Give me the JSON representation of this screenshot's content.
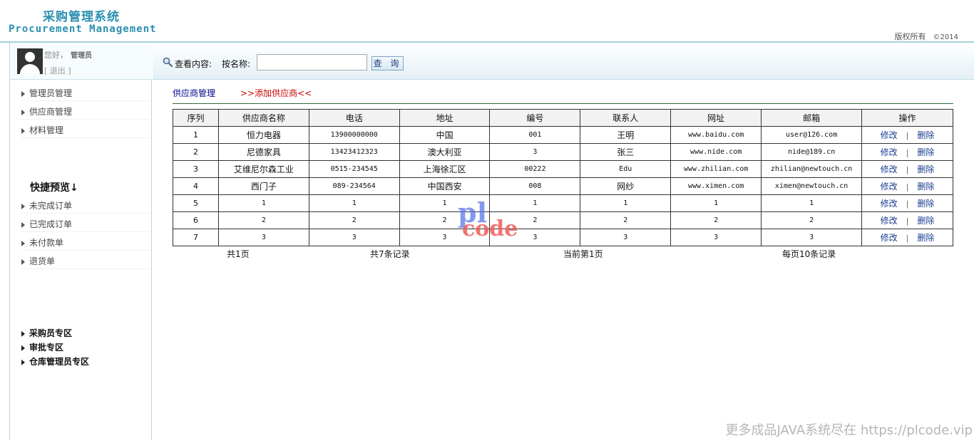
{
  "header": {
    "title_cn": "采购管理系统",
    "title_en": "Procurement Management",
    "copyright": "版权所有",
    "year": "©2014"
  },
  "user": {
    "greeting": "您好，",
    "role": "管理员",
    "logout": "[ 退出 ]"
  },
  "sidebar": {
    "menu": [
      "管理员管理",
      "供应商管理",
      "材料管理"
    ],
    "quick_title": "快捷预览↓",
    "quick": [
      "未完成订单",
      "已完成订单",
      "未付款单",
      "退货单"
    ],
    "zones": [
      "采购员专区",
      "审批专区",
      "仓库管理员专区"
    ]
  },
  "search": {
    "label": "查看内容:",
    "field_label": "按名称:",
    "value": "",
    "button": "查 询"
  },
  "content": {
    "breadcrumb": "供应商管理",
    "add_link": ">>添加供应商<<"
  },
  "table": {
    "headers": [
      "序列",
      "供应商名称",
      "电话",
      "地址",
      "编号",
      "联系人",
      "网址",
      "邮箱",
      "操作"
    ],
    "rows": [
      [
        "1",
        "恒力电器",
        "13900000000",
        "中国",
        "001",
        "王明",
        "www.baidu.com",
        "user@126.com"
      ],
      [
        "2",
        "尼德家具",
        "13423412323",
        "澳大利亚",
        "3",
        "张三",
        "www.nide.com",
        "nide@189.cn"
      ],
      [
        "3",
        "艾维尼尔森工业",
        "0515-234545",
        "上海徐汇区",
        "00222",
        "Edu",
        "www.zhilian.com",
        "zhilian@newtouch.cn"
      ],
      [
        "4",
        "西门子",
        "089-234564",
        "中国西安",
        "008",
        "网纱",
        "www.ximen.com",
        "ximen@newtouch.cn"
      ],
      [
        "5",
        "1",
        "1",
        "1",
        "1",
        "1",
        "1",
        "1"
      ],
      [
        "6",
        "2",
        "2",
        "2",
        "2",
        "2",
        "2",
        "2"
      ],
      [
        "7",
        "3",
        "3",
        "3",
        "3",
        "3",
        "3",
        "3"
      ]
    ],
    "edit_label": "修改",
    "separator": "|",
    "delete_label": "删除"
  },
  "pager": {
    "total_pages": "共1页",
    "total_records": "共7条记录",
    "current_page": "当前第1页",
    "per_page": "每页10条记录"
  },
  "watermark": {
    "line1": "pl",
    "line2": "code"
  },
  "footer_note": "更多成品JAVA系统尽在 https://plcode.vip"
}
